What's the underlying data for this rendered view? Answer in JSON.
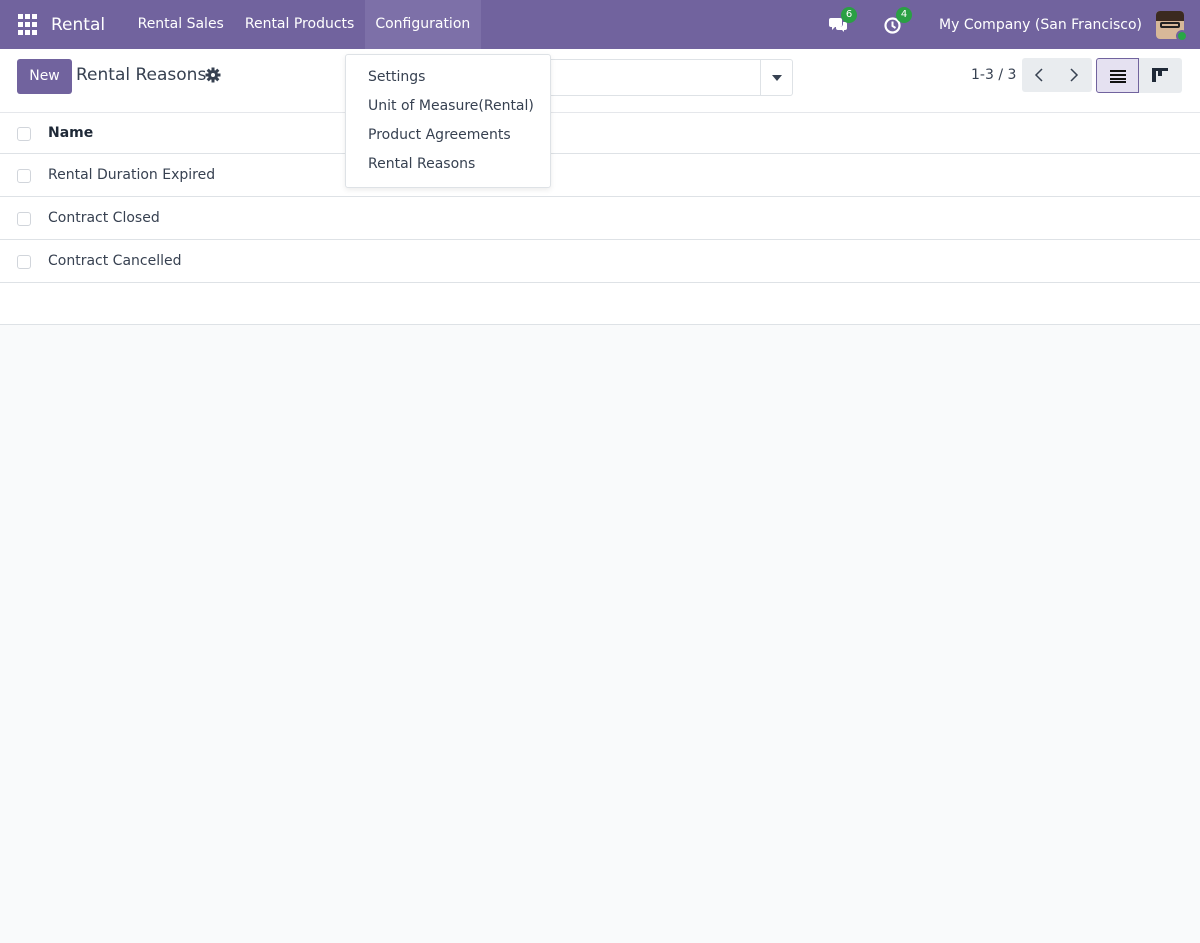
{
  "navbar": {
    "brand": "Rental",
    "menu": [
      {
        "label": "Rental Sales"
      },
      {
        "label": "Rental Products"
      },
      {
        "label": "Configuration"
      }
    ],
    "messages_count": "6",
    "activities_count": "4",
    "company": "My Company (San Francisco)",
    "accent_color": "#71639e"
  },
  "control_panel": {
    "new_label": "New",
    "title": "Rental Reasons",
    "pager": "1-3 / 3"
  },
  "list": {
    "columns": [
      "Name"
    ],
    "rows": [
      {
        "name": "Rental Duration Expired"
      },
      {
        "name": "Contract Closed"
      },
      {
        "name": "Contract Cancelled"
      }
    ]
  },
  "dropdown": {
    "items": [
      {
        "label": "Settings"
      },
      {
        "label": "Unit of Measure(Rental)"
      },
      {
        "label": "Product Agreements"
      },
      {
        "label": "Rental Reasons"
      }
    ]
  },
  "icons": {
    "apps": "apps-grid-icon",
    "messages": "chat-icon",
    "activities": "clock-icon",
    "settings": "gear-icon",
    "prev": "chevron-left-icon",
    "next": "chevron-right-icon",
    "list_view": "list-view-icon",
    "kanban_view": "kanban-view-icon"
  }
}
